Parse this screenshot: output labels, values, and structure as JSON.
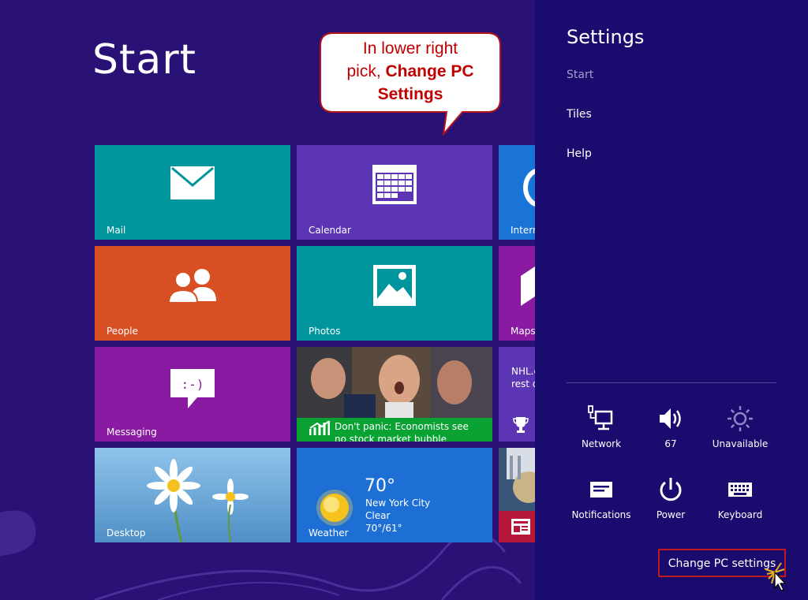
{
  "start": {
    "title": "Start"
  },
  "callout": {
    "line1": "In lower right",
    "line2_prefix": "pick, ",
    "line2_bold": "Change PC",
    "line3_bold": "Settings"
  },
  "tiles": {
    "mail": {
      "label": "Mail",
      "color": "#00949c"
    },
    "calendar": {
      "label": "Calendar",
      "color": "#5b35b3"
    },
    "internet": {
      "label": "Intern",
      "color": "#1a73d6"
    },
    "people": {
      "label": "People",
      "color": "#d84f24"
    },
    "photos": {
      "label": "Photos",
      "color": "#00949c"
    },
    "maps": {
      "label": "Maps",
      "color": "#8a1aa2"
    },
    "messaging": {
      "label": "Messaging",
      "color": "#8a1aa2"
    },
    "finance": {
      "headline_line1": "Don't panic: Economists see",
      "headline_line2": "no stock market bubble",
      "color": "#0aa333"
    },
    "sports": {
      "text_line1": "NHL.c",
      "text_line2": "rest o",
      "color": "#5b35b3"
    },
    "desktop": {
      "label": "Desktop"
    },
    "weather": {
      "label": "Weather",
      "temp": "70°",
      "city": "New York City",
      "condition": "Clear",
      "range": "70°/61°",
      "color": "#1d6fd6"
    },
    "news": {
      "color": "#b7183a"
    }
  },
  "charm": {
    "title": "Settings",
    "links": [
      "Start",
      "Tiles",
      "Help"
    ],
    "quick_settings": [
      {
        "icon": "network-icon",
        "label": "Network"
      },
      {
        "icon": "volume-icon",
        "label": "67"
      },
      {
        "icon": "brightness-icon",
        "label": "Unavailable"
      },
      {
        "icon": "notifications-icon",
        "label": "Notifications"
      },
      {
        "icon": "power-icon",
        "label": "Power"
      },
      {
        "icon": "keyboard-icon",
        "label": "Keyboard"
      }
    ],
    "change_pc_settings": "Change PC settings"
  },
  "colors": {
    "background": "#2a1175",
    "charm_background": "#1a0b6e",
    "highlight_border": "#c0181f",
    "callout_text": "#c00000"
  }
}
